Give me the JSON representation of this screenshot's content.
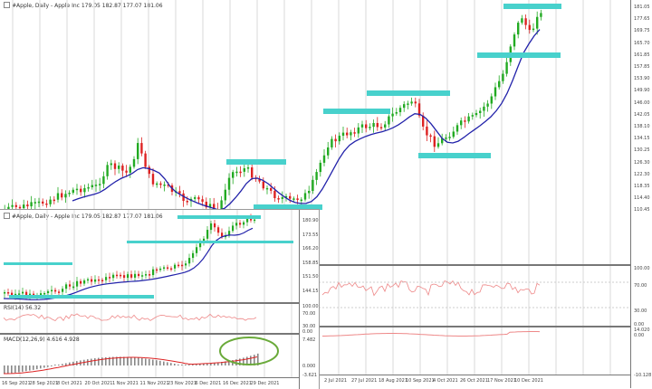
{
  "main_chart": {
    "title": "#Apple, Daily - Apple Inc  179.05 182.87 177.07 181.06",
    "price_axis": [
      "181.05",
      "177.65",
      "169.75",
      "165.70",
      "161.85",
      "157.85",
      "153.90",
      "149.90",
      "146.00",
      "142.05",
      "138.10",
      "134.15",
      "130.25",
      "126.30",
      "122.30",
      "118.35",
      "114.40",
      "110.45"
    ],
    "rsi_axis": [
      "100.00",
      "70.00",
      "30.00",
      "0.00"
    ],
    "macd_axis": [
      "14.020",
      "0.00",
      "-10.128"
    ],
    "dates": [
      "2 Jul 2021",
      "27 Jul 2021",
      "18 Aug 2021",
      "10 Sep 2021",
      "4 Oct 2021",
      "26 Oct 2021",
      "17 Nov 2021",
      "10 Dec 2021"
    ]
  },
  "sub_chart": {
    "title": "#Apple, Daily - Apple Inc  179.05 182.87 177.07 181.06",
    "price_axis": [
      "180.90",
      "173.55",
      "166.20",
      "158.85",
      "151.50",
      "144.15"
    ],
    "rsi_label": "RSI(14) 56.32",
    "rsi_axis": [
      "100.00",
      "70.00",
      "30.00",
      "0.00"
    ],
    "macd_label": "MACD(12,26,9) 4.616 4.928",
    "macd_axis": [
      "7.482",
      "0.000",
      "-3.621"
    ],
    "dates": [
      "16 Sep 2021",
      "28 Sep 2021",
      "8 Oct 2021",
      "20 Oct 2021",
      "1 Nov 2021",
      "11 Nov 2021",
      "23 Nov 2021",
      "6 Dec 2021",
      "16 Dec 2021",
      "29 Dec 2021"
    ]
  },
  "colors": {
    "bull": "#22aa22",
    "bear": "#dd2222",
    "ma": "#2222aa",
    "zone": "#48d1cc",
    "rsi": "#ee8888",
    "circle": "#6aaa3a"
  }
}
